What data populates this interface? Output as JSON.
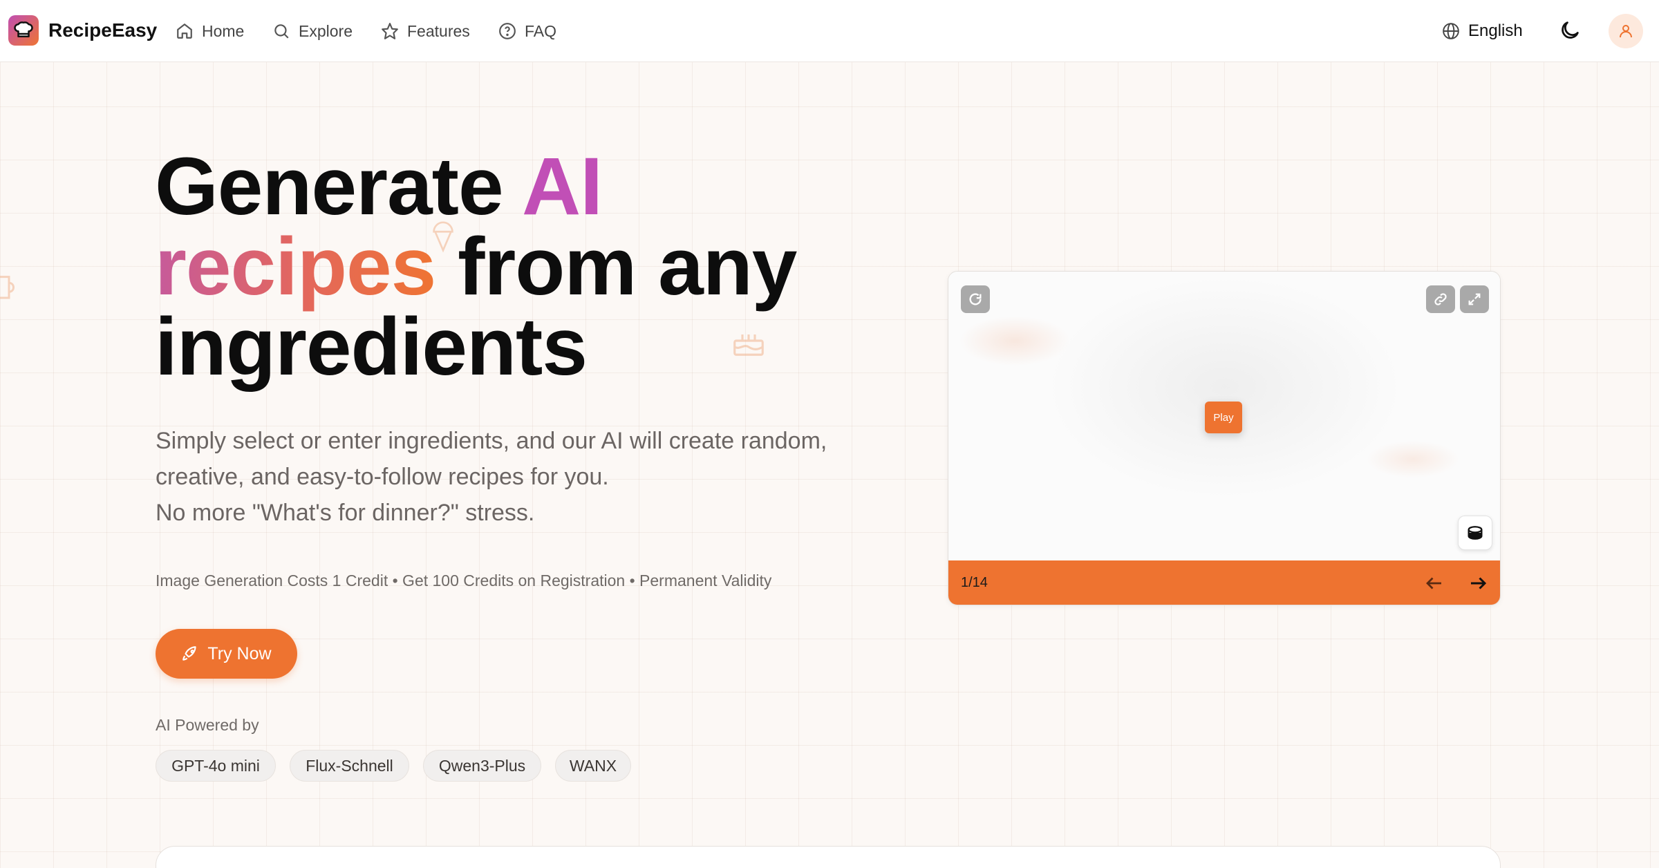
{
  "nav": {
    "brand": "RecipeEasy",
    "items": [
      {
        "label": "Home",
        "icon": "home-icon"
      },
      {
        "label": "Explore",
        "icon": "search-icon"
      },
      {
        "label": "Features",
        "icon": "star-icon"
      },
      {
        "label": "FAQ",
        "icon": "help-circle-icon"
      }
    ],
    "language": "English"
  },
  "hero": {
    "title_part1": "Generate ",
    "title_ai": "AI",
    "title_recipes": "recipes",
    "title_part2": " from any",
    "title_part3": "ingredients",
    "subtitle_line1": "Simply select or enter ingredients, and our AI will create random,",
    "subtitle_line2": "creative, and easy-to-follow recipes for you.",
    "subtitle_line3": "No more \"What's for dinner?\" stress.",
    "credits_text": "Image Generation Costs 1 Credit • Get 100 Credits on Registration • Permanent Validity",
    "cta_label": "Try Now",
    "powered_label": "AI Powered by",
    "models": [
      "GPT-4o mini",
      "Flux-Schnell",
      "Qwen3-Plus",
      "WANX"
    ]
  },
  "media": {
    "play_label": "Play",
    "counter": "1/14"
  },
  "colors": {
    "accent": "#ee7330",
    "pink": "#c14fb6",
    "background": "#fcf8f5"
  }
}
